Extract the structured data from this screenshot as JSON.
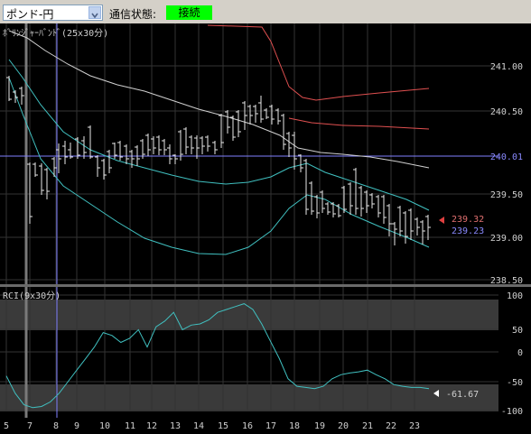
{
  "toolbar": {
    "currency_pair": "ポンド-円",
    "status_label": "通信状態:",
    "status_value": "接続",
    "status_color": "#00ff00"
  },
  "chart_data": [
    {
      "type": "candlestick",
      "title": "ﾎﾞﾘﾝｼﾞｬｰﾊﾞﾝﾄﾞ(25x30分)",
      "y_ticks": [
        "241.00",
        "240.50",
        "240.01",
        "239.50",
        "239.00",
        "238.50"
      ],
      "ylim": [
        238.5,
        241.4
      ],
      "current_price": "240.01",
      "price_markers": [
        {
          "label": "239.32",
          "value": 239.32,
          "color": "#e07070"
        },
        {
          "label": "239.23",
          "value": 239.23,
          "color": "#8a8aff"
        }
      ],
      "grid": true
    },
    {
      "type": "line",
      "title": "RCI(9x30分)",
      "y_ticks": [
        "100",
        "50",
        "0",
        "-50",
        "-100"
      ],
      "ylim": [
        -100,
        100
      ],
      "current_value": "-61.67",
      "values": [
        -40,
        -70,
        -90,
        -95,
        -93,
        -85,
        -70,
        -50,
        -30,
        -10,
        10,
        35,
        30,
        18,
        25,
        40,
        10,
        45,
        55,
        70,
        40,
        48,
        50,
        57,
        70,
        75,
        80,
        85,
        75,
        50,
        20,
        -10,
        -45,
        -58,
        -60,
        -62,
        -58,
        -45,
        -38,
        -35,
        -33,
        -30,
        -38,
        -45,
        -55,
        -58,
        -60,
        -60,
        -62
      ]
    }
  ],
  "x_axis": {
    "ticks": [
      "5",
      "7",
      "8",
      "9",
      "10",
      "11",
      "12",
      "13",
      "14",
      "15",
      "16",
      "17",
      "18",
      "19",
      "20",
      "21",
      "22",
      "23"
    ]
  }
}
